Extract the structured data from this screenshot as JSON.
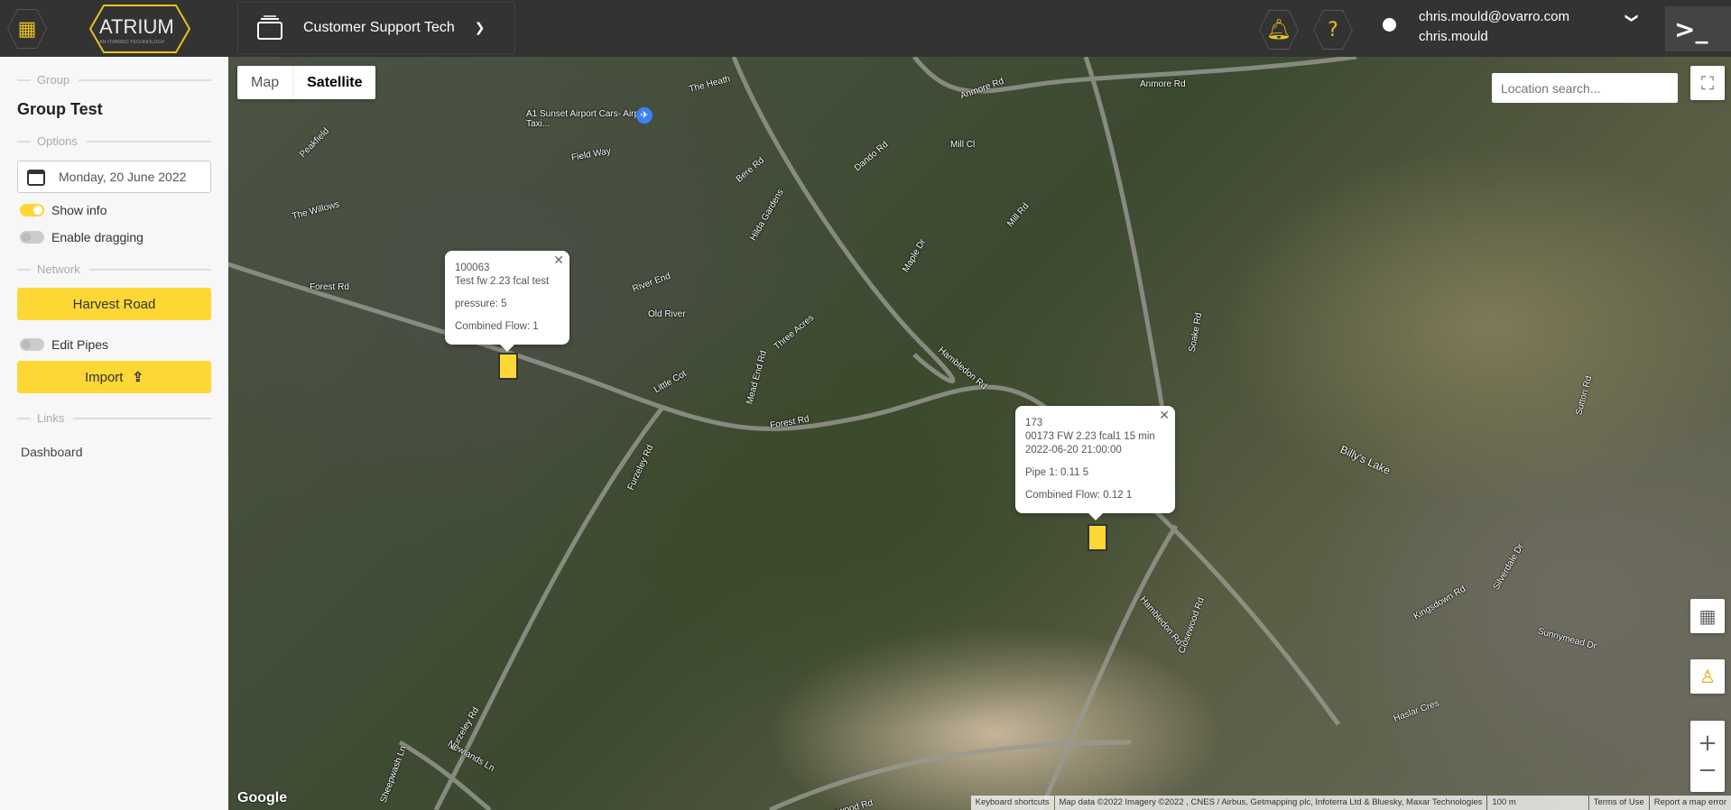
{
  "header": {
    "logo_text": "ATRIUM",
    "logo_sub": "AN OVARRO TECHNOLOGY",
    "org_name": "Customer Support Tech",
    "user_email": "chris.mould@ovarro.com",
    "user_name": "chris.mould",
    "accent": "#e9c21c"
  },
  "sidebar": {
    "group_label": "Group",
    "group_name": "Group Test",
    "options_label": "Options",
    "date": "Monday, 20 June 2022",
    "show_info": {
      "label": "Show info",
      "on": true
    },
    "enable_dragging": {
      "label": "Enable dragging",
      "on": false
    },
    "network_label": "Network",
    "network_button": "Harvest Road",
    "edit_pipes": {
      "label": "Edit Pipes",
      "on": false
    },
    "import_button": "Import",
    "links_label": "Links",
    "dashboard_link": "Dashboard"
  },
  "map": {
    "type_tabs": [
      "Map",
      "Satellite"
    ],
    "active_type": "Satellite",
    "search_placeholder": "Location search...",
    "streets": [
      "Forest Rd",
      "Hambledon Rd",
      "Furzeley Rd",
      "Soake Rd",
      "Anmore Rd",
      "Closewood Rd",
      "Mill Rd",
      "Maple Dr",
      "Old River",
      "River End",
      "Three Acres",
      "Mead End Rd",
      "Hilda Gardens",
      "Bere Rd",
      "Field Way",
      "The Willows",
      "Peakfield",
      "Silverdale Dr",
      "Sunnymead Dr",
      "Kingsdown Rd",
      "Haslar Cres",
      "Sutton Rd",
      "Billy's Lake",
      "Newlands Ln",
      "Sheepwash Ln",
      "Little Cot",
      "Mill Cl",
      "Dando Rd",
      "The Heath"
    ],
    "poi": "A1 Sunset Airport Cars- Airport Taxi...",
    "popups": [
      {
        "id": "100063",
        "lines": [
          "Test fw 2.23 fcal test"
        ],
        "extra": [
          "pressure: 5",
          "Combined Flow: 1"
        ]
      },
      {
        "id": "173",
        "lines": [
          "00173 FW 2.23 fcal1 15 min",
          "2022-06-20 21:00:00"
        ],
        "extra": [
          "Pipe 1: 0.11 5",
          "Combined Flow: 0.12 1"
        ]
      }
    ],
    "google": "Google",
    "attribution": [
      "Keyboard shortcuts",
      "Map data ©2022 Imagery ©2022 , CNES / Airbus, Getmapping plc, Infoterra Ltd & Bluesky, Maxar Technologies",
      "100 m",
      "Terms of Use",
      "Report a map error"
    ]
  }
}
